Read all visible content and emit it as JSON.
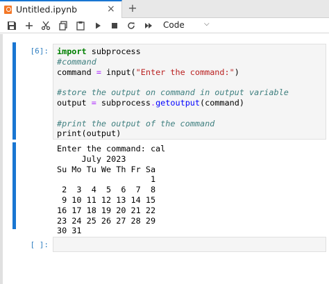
{
  "tab": {
    "title": "Untitled.ipynb",
    "close_glyph": "×",
    "new_glyph": "+"
  },
  "toolbar": {
    "cell_type": "Code"
  },
  "cells": [
    {
      "prompt": "[6]:",
      "lines": [
        [
          {
            "t": "import",
            "c": "kw"
          },
          {
            "t": " subprocess",
            "c": ""
          }
        ],
        [
          {
            "t": "#command",
            "c": "cm"
          }
        ],
        [
          {
            "t": "command ",
            "c": ""
          },
          {
            "t": "=",
            "c": "op"
          },
          {
            "t": " input(",
            "c": ""
          },
          {
            "t": "\"Enter the command:\"",
            "c": "st"
          },
          {
            "t": ")",
            "c": ""
          }
        ],
        [],
        [
          {
            "t": "#store the output on command in output variable",
            "c": "cm"
          }
        ],
        [
          {
            "t": "output ",
            "c": ""
          },
          {
            "t": "=",
            "c": "op"
          },
          {
            "t": " subprocess",
            "c": ""
          },
          {
            "t": ".",
            "c": "op"
          },
          {
            "t": "getoutput",
            "c": "fn"
          },
          {
            "t": "(command)",
            "c": ""
          }
        ],
        [],
        [
          {
            "t": "#print the output of the command",
            "c": "cm"
          }
        ],
        [
          {
            "t": "print(output)",
            "c": ""
          }
        ]
      ],
      "output": [
        "Enter the command: cal",
        "     July 2023",
        "Su Mo Tu We Th Fr Sa",
        "                   1",
        " 2  3  4  5  6  7  8",
        " 9 10 11 12 13 14 15",
        "16 17 18 19 20 21 22",
        "23 24 25 26 27 28 29",
        "30 31"
      ]
    },
    {
      "prompt": "[ ]:"
    }
  ]
}
